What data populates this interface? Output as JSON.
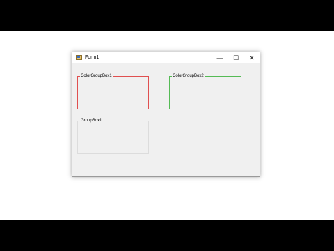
{
  "window": {
    "title": "Form1",
    "icon": "form-app-icon",
    "controls": {
      "minimize_glyph": "—",
      "maximize_glyph": "☐",
      "close_glyph": "✕"
    }
  },
  "groupboxes": [
    {
      "label": "ColorGroupBox1",
      "border_color": "#e05050"
    },
    {
      "label": "ColorGroupBox2",
      "border_color": "#55bb55"
    },
    {
      "label": "GroupBox1",
      "border_color": "#dcdcdc"
    }
  ]
}
